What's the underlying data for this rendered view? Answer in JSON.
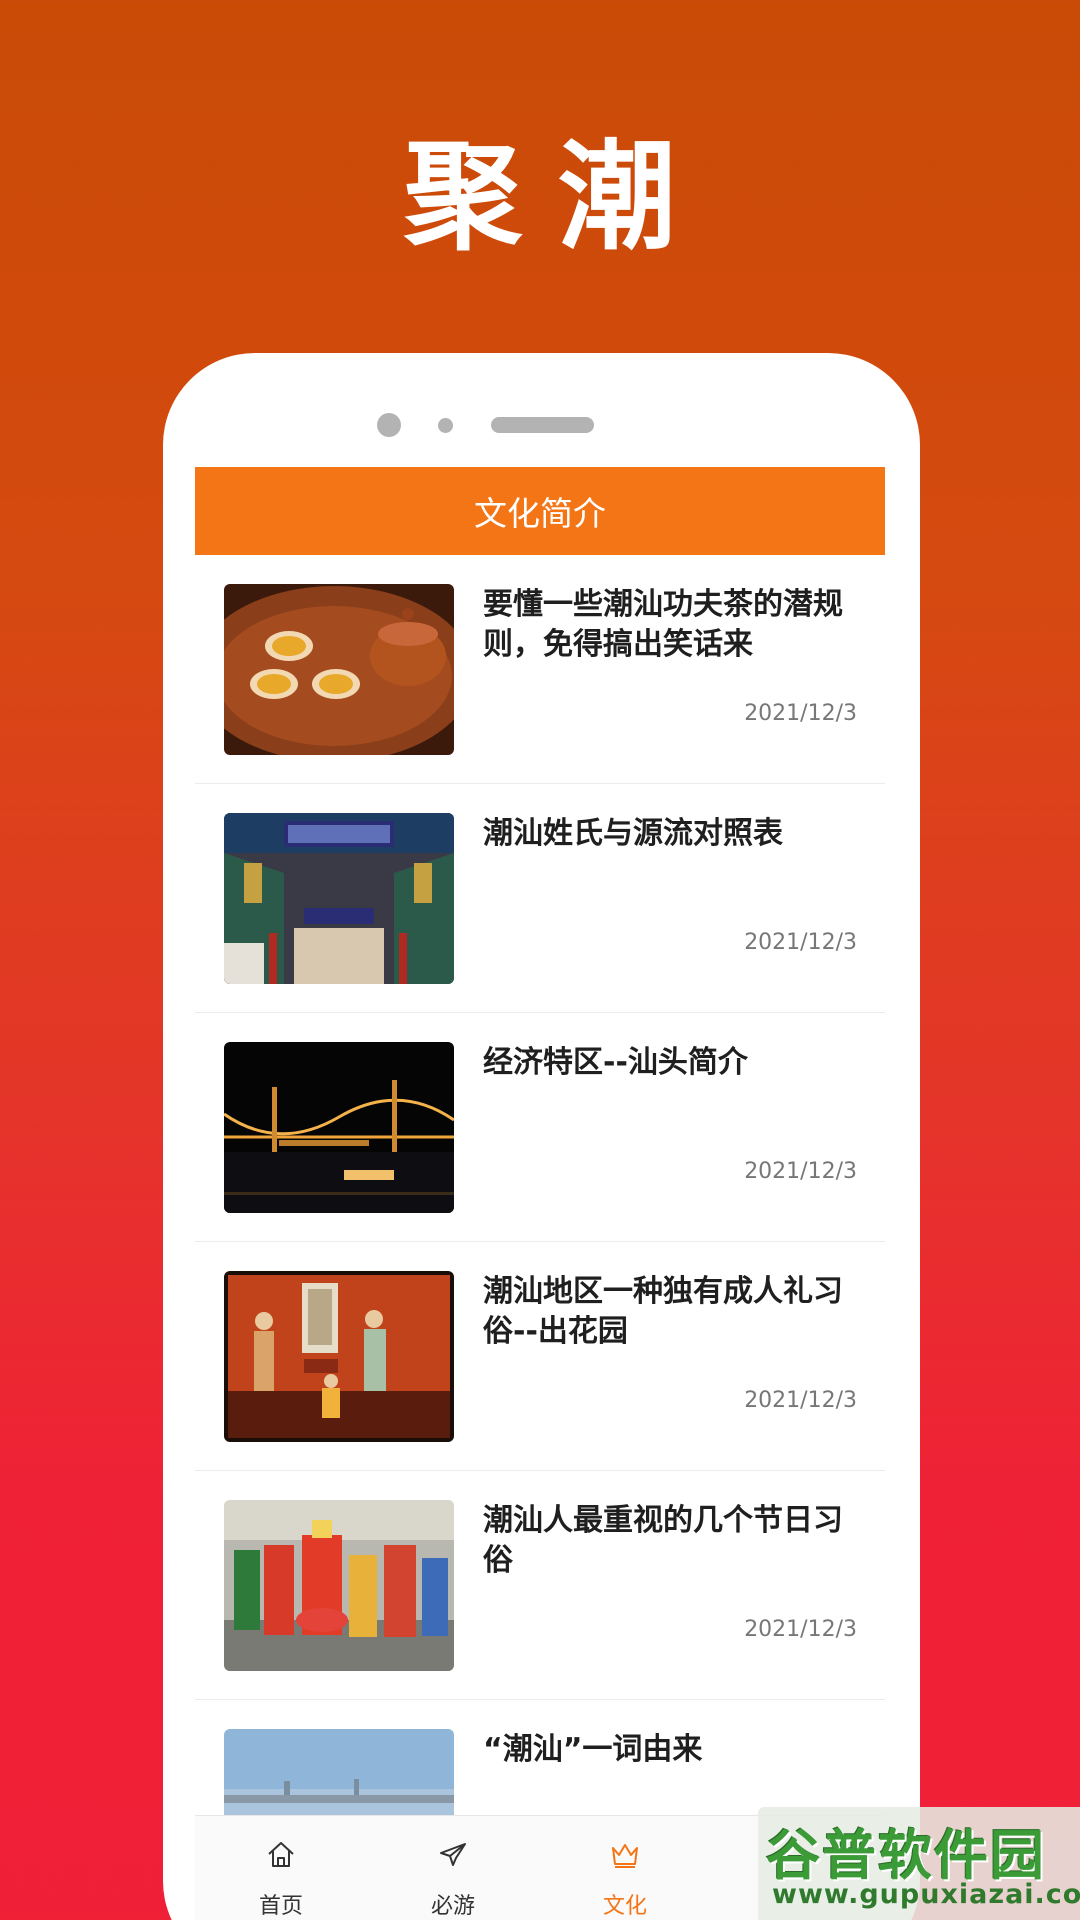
{
  "promo": {
    "title": "聚潮"
  },
  "header": {
    "title": "文化简介"
  },
  "articles": [
    {
      "title": "要懂一些潮汕功夫茶的潜规则，免得搞出笑话来",
      "date": "2021/12/3"
    },
    {
      "title": "潮汕姓氏与源流对照表",
      "date": "2021/12/3"
    },
    {
      "title": "经济特区--汕头简介",
      "date": "2021/12/3"
    },
    {
      "title": "潮汕地区一种独有成人礼习俗--出花园",
      "date": "2021/12/3"
    },
    {
      "title": "潮汕人最重视的几个节日习俗",
      "date": "2021/12/3"
    },
    {
      "title": "“潮汕”一词由来",
      "date": ""
    }
  ],
  "tabs": [
    {
      "label": "首页",
      "icon": "home-icon"
    },
    {
      "label": "必游",
      "icon": "plane-icon"
    },
    {
      "label": "文化",
      "icon": "crown-icon",
      "active": true
    }
  ],
  "watermark": {
    "main": "谷普软件园",
    "url": "www.gupuxiazai.com"
  },
  "colors": {
    "accent": "#f47516",
    "background_top": "#c94b06",
    "background_bottom": "#f01f38"
  }
}
